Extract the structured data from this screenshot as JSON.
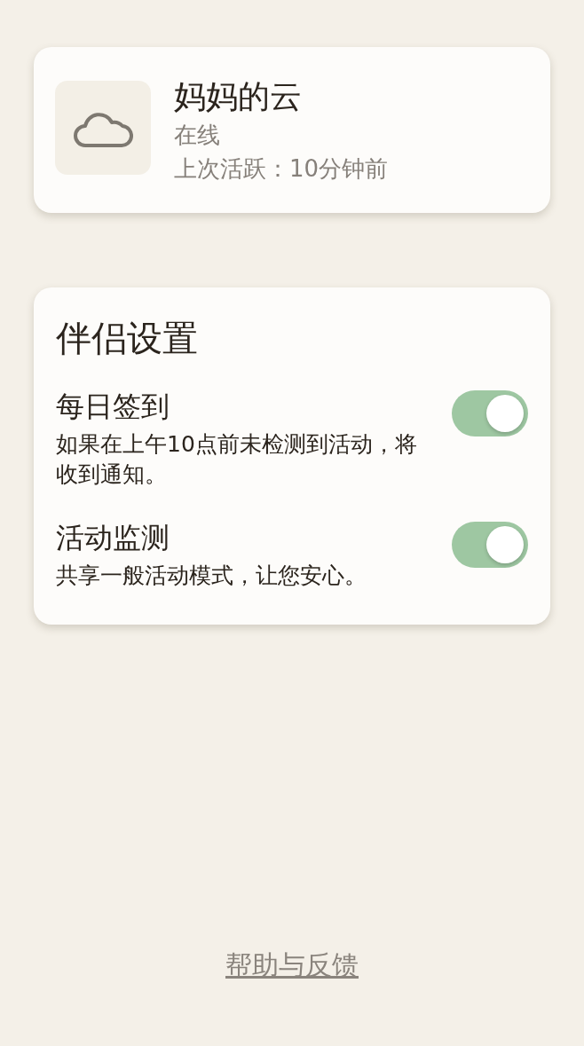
{
  "device": {
    "name": "妈妈的云",
    "status": "在线",
    "last_active": "上次活跃：10分钟前"
  },
  "settings": {
    "title": "伴侣设置",
    "items": [
      {
        "label": "每日签到",
        "description": "如果在上午10点前未检测到活动，将收到通知。",
        "on": true
      },
      {
        "label": "活动监测",
        "description": "共享一般活动模式，让您安心。",
        "on": true
      }
    ]
  },
  "footer_link": "帮助与反馈"
}
